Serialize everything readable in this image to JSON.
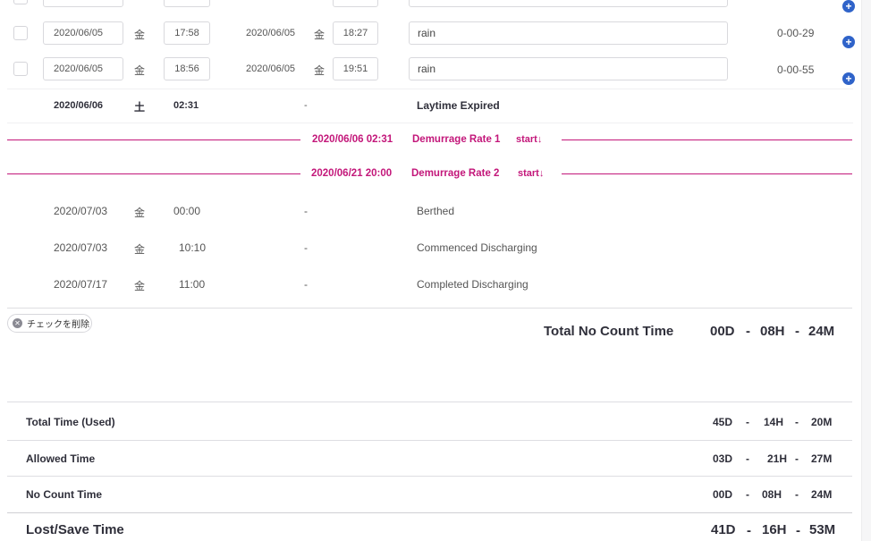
{
  "rows": [
    {
      "start_date": "2020/06/05",
      "start_day": "金",
      "start_time": "17:58",
      "end_date": "2020/06/05",
      "end_day": "金",
      "end_time": "18:27",
      "remark": "rain",
      "duration": "0-00-29"
    },
    {
      "start_date": "2020/06/05",
      "start_day": "金",
      "start_time": "18:56",
      "end_date": "2020/06/05",
      "end_day": "金",
      "end_time": "19:51",
      "remark": "rain",
      "duration": "0-00-55"
    }
  ],
  "expired": {
    "date": "2020/06/06",
    "day": "土",
    "time": "02:31",
    "dash": "-",
    "label": "Laytime Expired"
  },
  "rates": [
    {
      "datetime": "2020/06/06 02:31",
      "name": "Demurrage Rate 1",
      "start": "start↓"
    },
    {
      "datetime": "2020/06/21 20:00",
      "name": "Demurrage Rate 2",
      "start": "start↓"
    }
  ],
  "events": [
    {
      "date": "2020/07/03",
      "day": "金",
      "time": "00:00",
      "dash": "-",
      "label": "Berthed"
    },
    {
      "date": "2020/07/03",
      "day": "金",
      "time": "10:10",
      "dash": "-",
      "label": "Commenced Discharging"
    },
    {
      "date": "2020/07/17",
      "day": "金",
      "time": "11:00",
      "dash": "-",
      "label": "Completed Discharging"
    }
  ],
  "clear_checks_label": "チェックを削除",
  "total_no_count": {
    "label": "Total No Count Time",
    "d": "00D",
    "h": "08H",
    "m": "24M",
    "sep": "-"
  },
  "summary": [
    {
      "label": "Total Time (Used)",
      "d": "45D",
      "h": "14H",
      "m": "20M"
    },
    {
      "label": "Allowed Time",
      "d": "03D",
      "h": "21H",
      "m": "27M"
    },
    {
      "label": "No Count Time",
      "d": "00D",
      "h": "08H",
      "m": "24M"
    },
    {
      "label": "Lost/Save Time",
      "d": "41D",
      "h": "16H",
      "m": "53M"
    }
  ],
  "sep": "-",
  "colors": {
    "accent": "#c3177a",
    "plus_button": "#2f63c9"
  },
  "icons": {
    "add": "plus-circle-icon",
    "clear": "close-circle-icon"
  }
}
